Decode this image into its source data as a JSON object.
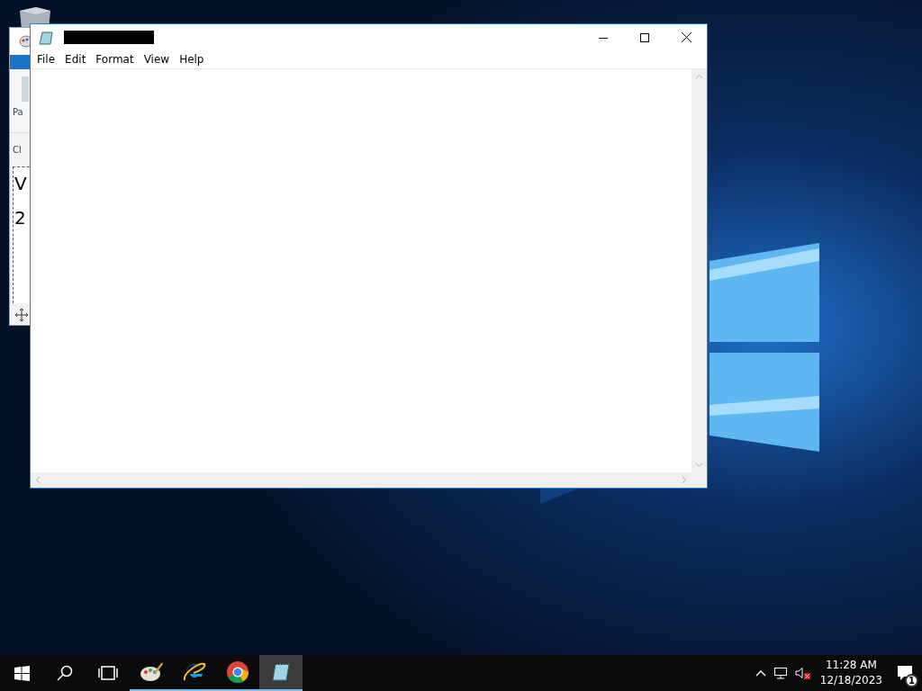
{
  "paint_window": {
    "paste_label": "Pa",
    "clipboard_label": "Cl",
    "canvas_lines": [
      "V",
      "2"
    ]
  },
  "notepad": {
    "menu": [
      "File",
      "Edit",
      "Format",
      "View",
      "Help"
    ]
  },
  "taskbar": {
    "apps": [
      {
        "kind": "paint",
        "running": true,
        "selected": false
      },
      {
        "kind": "ie",
        "running": true,
        "selected": false
      },
      {
        "kind": "chrome",
        "running": true,
        "selected": false
      },
      {
        "kind": "notepad",
        "running": true,
        "selected": true
      }
    ],
    "clock": {
      "time": "11:28 AM",
      "date": "12/18/2023"
    },
    "notifications": {
      "count": "1"
    }
  }
}
